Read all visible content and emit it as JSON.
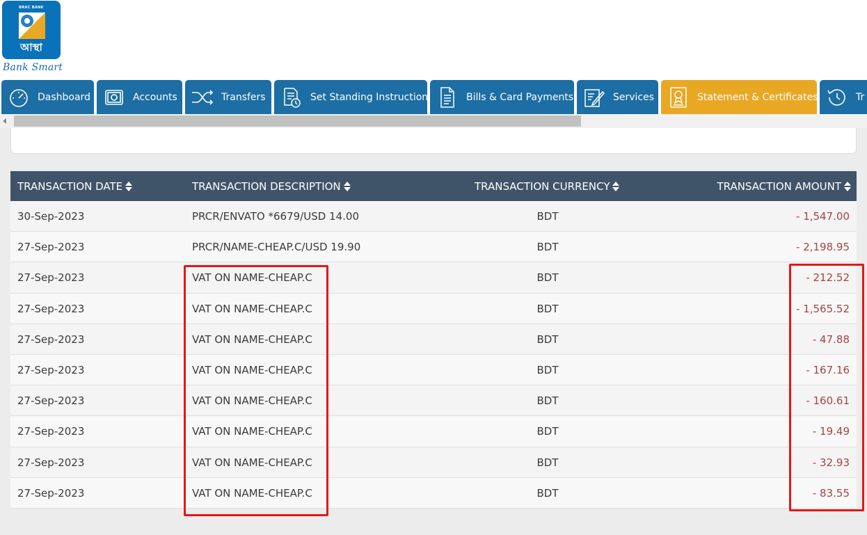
{
  "logo": {
    "brand": "BRAC BANK",
    "script": "আস্থা",
    "tagline": "Bank Smart"
  },
  "tabs": [
    {
      "label": "Dashboard",
      "icon": "speedometer-icon"
    },
    {
      "label": "Accounts",
      "icon": "safe-icon"
    },
    {
      "label": "Transfers",
      "icon": "shuffle-icon"
    },
    {
      "label": "Set Standing Instruction",
      "icon": "document-clock-icon"
    },
    {
      "label": "Bills & Card Payments",
      "icon": "document-icon"
    },
    {
      "label": "Services",
      "icon": "pen-paper-icon"
    },
    {
      "label": "Statement & Certificates",
      "icon": "certificate-icon",
      "active": true
    },
    {
      "label": "Tr",
      "icon": "history-icon"
    }
  ],
  "table": {
    "headers": {
      "date": "TRANSACTION DATE",
      "description": "TRANSACTION DESCRIPTION",
      "currency": "TRANSACTION CURRENCY",
      "amount": "TRANSACTION AMOUNT"
    },
    "rows": [
      {
        "date": "30-Sep-2023",
        "description": "PRCR/ENVATO *6679/USD 14.00",
        "currency": "BDT",
        "amount": "- 1,547.00"
      },
      {
        "date": "27-Sep-2023",
        "description": "PRCR/NAME-CHEAP.C/USD 19.90",
        "currency": "BDT",
        "amount": "- 2,198.95"
      },
      {
        "date": "27-Sep-2023",
        "description": "VAT ON NAME-CHEAP.C",
        "currency": "BDT",
        "amount": "- 212.52"
      },
      {
        "date": "27-Sep-2023",
        "description": "VAT ON NAME-CHEAP.C",
        "currency": "BDT",
        "amount": "- 1,565.52"
      },
      {
        "date": "27-Sep-2023",
        "description": "VAT ON NAME-CHEAP.C",
        "currency": "BDT",
        "amount": "- 47.88"
      },
      {
        "date": "27-Sep-2023",
        "description": "VAT ON NAME-CHEAP.C",
        "currency": "BDT",
        "amount": "- 167.16"
      },
      {
        "date": "27-Sep-2023",
        "description": "VAT ON NAME-CHEAP.C",
        "currency": "BDT",
        "amount": "- 160.61"
      },
      {
        "date": "27-Sep-2023",
        "description": "VAT ON NAME-CHEAP.C",
        "currency": "BDT",
        "amount": "- 19.49"
      },
      {
        "date": "27-Sep-2023",
        "description": "VAT ON NAME-CHEAP.C",
        "currency": "BDT",
        "amount": "- 32.93"
      },
      {
        "date": "27-Sep-2023",
        "description": "VAT ON NAME-CHEAP.C",
        "currency": "BDT",
        "amount": "- 83.55"
      }
    ]
  },
  "colors": {
    "tab_bg": "#1c6ea4",
    "tab_active_bg": "#e9a824",
    "header_bg": "#3f5468",
    "amount_text": "#a44444",
    "highlight": "#e41717"
  }
}
